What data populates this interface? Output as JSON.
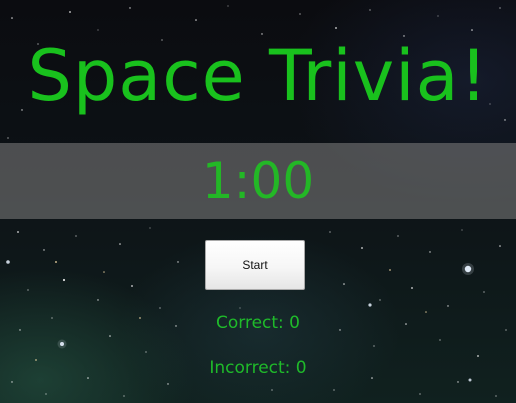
{
  "game": {
    "title": "Space Trivia!",
    "timer": "1:00",
    "start_label": "Start",
    "correct_text": "Correct: 0",
    "incorrect_text": "Incorrect: 0"
  },
  "colors": {
    "title_green": "#19c11d",
    "timer_green": "#23b726",
    "score_green": "#1fba2a",
    "timer_band": "rgba(120,120,120,0.6)"
  }
}
